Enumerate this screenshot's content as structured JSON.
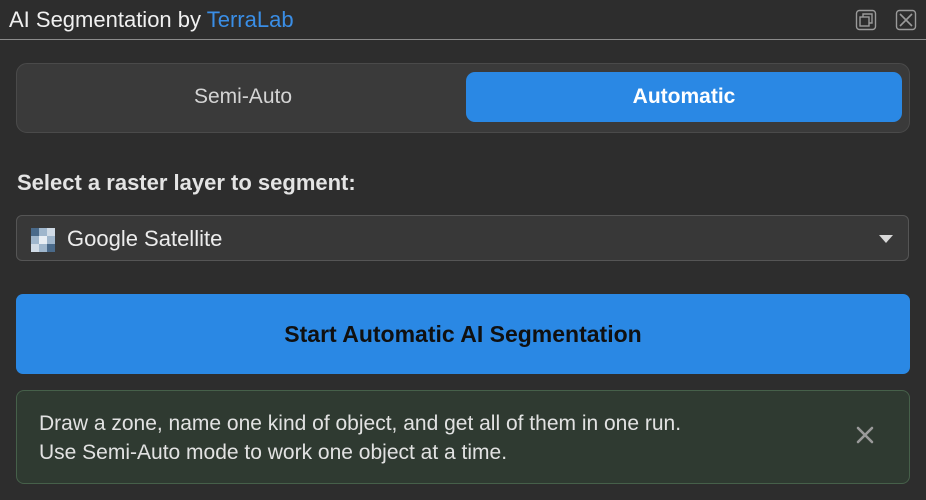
{
  "window": {
    "title_prefix": "AI Segmentation by",
    "title_brand": "TerraLab",
    "float_button_icon": "float-window-icon",
    "close_button_icon": "close-icon"
  },
  "mode_tabs": [
    {
      "label": "Semi-Auto",
      "selected": false
    },
    {
      "label": "Automatic",
      "selected": true
    }
  ],
  "layer_section": {
    "label": "Select a raster layer to segment:",
    "selected_layer": "Google Satellite",
    "layer_icon": "raster-layer-icon"
  },
  "start_button": {
    "label": "Start Automatic AI Segmentation"
  },
  "info": {
    "line1": "Draw a zone, name one kind of object, and get all of them in one run.",
    "line2": "Use Semi-Auto mode to work one object at a time.",
    "dismiss_icon": "close-icon"
  },
  "colors": {
    "accent": "#2a88e4",
    "brand": "#3a8ee6",
    "background": "#2d2d2d",
    "info_background": "#2f3a31",
    "info_border": "#46604a"
  }
}
